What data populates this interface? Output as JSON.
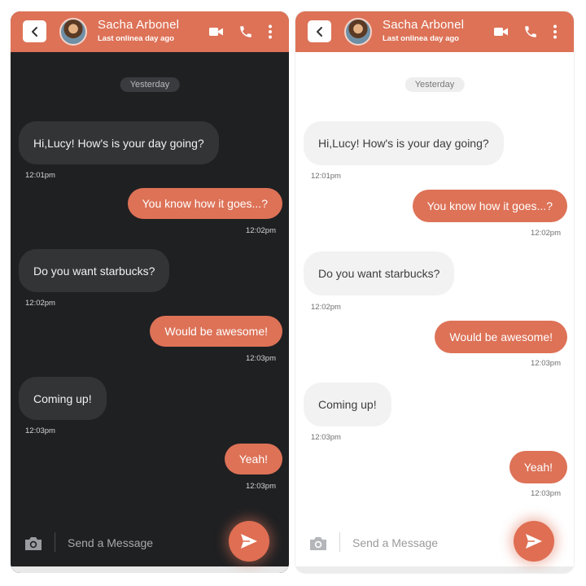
{
  "colors": {
    "accent": "#dd7257",
    "dark_bg": "#1f2022",
    "light_bg": "#ffffff"
  },
  "icons": [
    "back-chevron-icon",
    "video-camera-icon",
    "phone-icon",
    "more-vert-icon",
    "camera-icon",
    "send-icon"
  ],
  "screens": [
    {
      "theme": "dark",
      "header": {
        "name": "Sacha Arbonel",
        "status": "Last onlinea day ago"
      },
      "date_pill": "Yesterday",
      "messages": [
        {
          "text": "Hi,Lucy! How's is your day going?",
          "time": "12:01pm",
          "direction": "received"
        },
        {
          "text": "You know how it goes...?",
          "time": "12:02pm",
          "direction": "sent"
        },
        {
          "text": "Do you want starbucks?",
          "time": "12:02pm",
          "direction": "received"
        },
        {
          "text": "Would be awesome!",
          "time": "12:03pm",
          "direction": "sent"
        },
        {
          "text": "Coming up!",
          "time": "12:03pm",
          "direction": "received"
        },
        {
          "text": "Yeah!",
          "time": "12:03pm",
          "direction": "sent"
        }
      ],
      "composer": {
        "placeholder": "Send a Message"
      }
    },
    {
      "theme": "light",
      "header": {
        "name": "Sacha Arbonel",
        "status": "Last onlinea day ago"
      },
      "date_pill": "Yesterday",
      "messages": [
        {
          "text": "Hi,Lucy! How's is your day going?",
          "time": "12:01pm",
          "direction": "received"
        },
        {
          "text": "You know how it goes...?",
          "time": "12:02pm",
          "direction": "sent"
        },
        {
          "text": "Do you want starbucks?",
          "time": "12:02pm",
          "direction": "received"
        },
        {
          "text": "Would be awesome!",
          "time": "12:03pm",
          "direction": "sent"
        },
        {
          "text": "Coming up!",
          "time": "12:03pm",
          "direction": "received"
        },
        {
          "text": "Yeah!",
          "time": "12:03pm",
          "direction": "sent"
        }
      ],
      "composer": {
        "placeholder": "Send a Message"
      }
    }
  ]
}
